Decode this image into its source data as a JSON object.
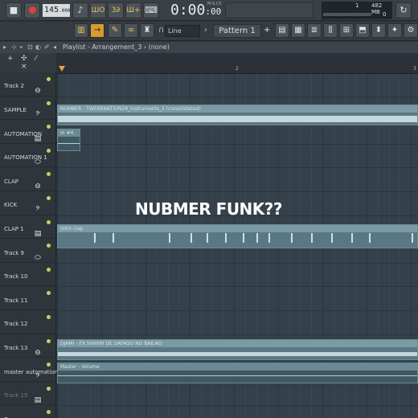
{
  "transport": {
    "stop_icon": "square-stop-icon",
    "record_icon": "record-icon",
    "tempo": "145",
    "tempo_decimal": ".000",
    "mode_pat": "ШО",
    "mode_song": "3∂",
    "mode_step": "Ш+",
    "time_main": "0:00",
    "time_fraction": ":00",
    "time_units": "M:S:CS",
    "cpu_value": "1",
    "memory": "482 MB",
    "poly": "0"
  },
  "toolbar": {
    "snap_value": "Line",
    "pattern_label": "Pattern 1"
  },
  "playlist": {
    "title": "Playlist - Arrangement_3",
    "selected": "(none)",
    "ruler_marks": [
      "2",
      "3"
    ]
  },
  "tracks": [
    {
      "name": "Track 2",
      "icon": "drum-icon"
    },
    {
      "name": "SAMPLE",
      "icon": "bass-clef-icon"
    },
    {
      "name": "AUTOMATION",
      "icon": "mixer-icon"
    },
    {
      "name": "AUTOMATION 1",
      "icon": "ellipse-icon"
    },
    {
      "name": "CLAP",
      "icon": "drum-icon"
    },
    {
      "name": "KICK",
      "icon": "bass-clef-icon"
    },
    {
      "name": "CLAP 1",
      "icon": "mixer-icon"
    },
    {
      "name": "Track 9",
      "icon": "ellipse-icon"
    },
    {
      "name": "Track 10",
      "icon": ""
    },
    {
      "name": "Track 11",
      "icon": ""
    },
    {
      "name": "Track 12",
      "icon": ""
    },
    {
      "name": "Track 13",
      "icon": "drum-icon"
    },
    {
      "name": "master automation",
      "icon": "bass-clef-icon"
    },
    {
      "name": "Track 15",
      "icon": "mixer-icon"
    },
    {
      "name": "Drums",
      "icon": "ellipse-icon"
    }
  ],
  "clips": {
    "sample_clip": "NUMBER - TWERKNATION28_instruments_2 (consolidated)",
    "automation_clip": "In  #4",
    "clap_clip": "intro clap",
    "track13_clip": "DJAMI - FX SHHHH DE SAFADO NO BAILAO",
    "master_clip": "Master - Volume"
  },
  "overlay_text": "NUBMER FUNK??",
  "colors": {
    "accent": "#e0a640",
    "record": "#e0403a",
    "indicator": "#b9d85a"
  }
}
